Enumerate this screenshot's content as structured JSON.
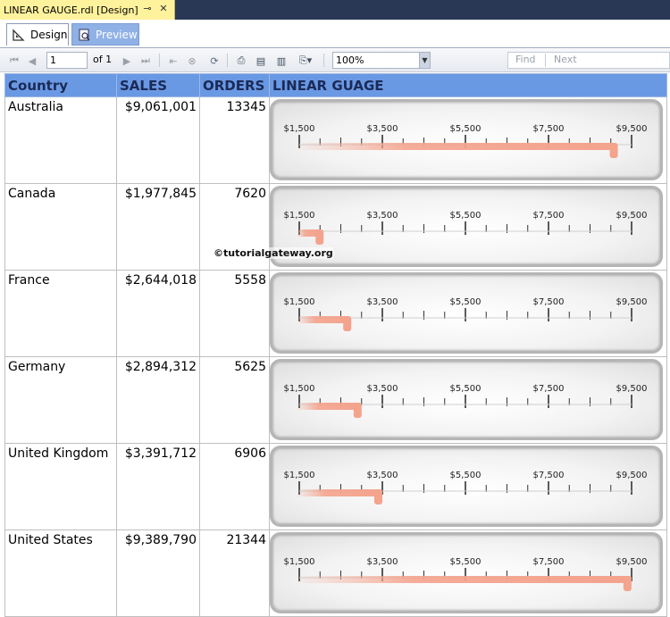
{
  "document_tab": {
    "title": "LINEAR GAUGE.rdl [Design]",
    "pin_icon": "pin-icon",
    "close_icon": "close-icon"
  },
  "view_tabs": [
    {
      "label": "Design",
      "icon": "design-icon",
      "active": false
    },
    {
      "label": "Preview",
      "icon": "preview-icon",
      "active": true
    }
  ],
  "toolbar": {
    "page_value": "1",
    "page_of": "of 1",
    "zoom_value": "100%",
    "find_label": "Find",
    "next_label": "Next"
  },
  "report": {
    "columns": [
      "Country",
      "SALES",
      "ORDERS",
      "LINEAR GUAGE"
    ],
    "rows": [
      {
        "country": "Australia",
        "sales": "$9,061,001",
        "orders": "13345",
        "gauge_value": 9061001
      },
      {
        "country": "Canada",
        "sales": "$1,977,845",
        "orders": "7620",
        "gauge_value": 1977845
      },
      {
        "country": "France",
        "sales": "$2,644,018",
        "orders": "5558",
        "gauge_value": 2644018
      },
      {
        "country": "Germany",
        "sales": "$2,894,312",
        "orders": "5625",
        "gauge_value": 2894312
      },
      {
        "country": "United Kingdom",
        "sales": "$3,391,712",
        "orders": "6906",
        "gauge_value": 3391712
      },
      {
        "country": "United States",
        "sales": "$9,389,790",
        "orders": "21344",
        "gauge_value": 9389790
      }
    ],
    "gauge_scale": {
      "min": 1500000,
      "max": 9500000,
      "tick_labels": [
        "$1,500",
        "$3,500",
        "$5,500",
        "$7,500",
        "$9,500"
      ],
      "pointer_color": "#f4a38d"
    }
  },
  "watermark": "©tutorialgateway.org"
}
